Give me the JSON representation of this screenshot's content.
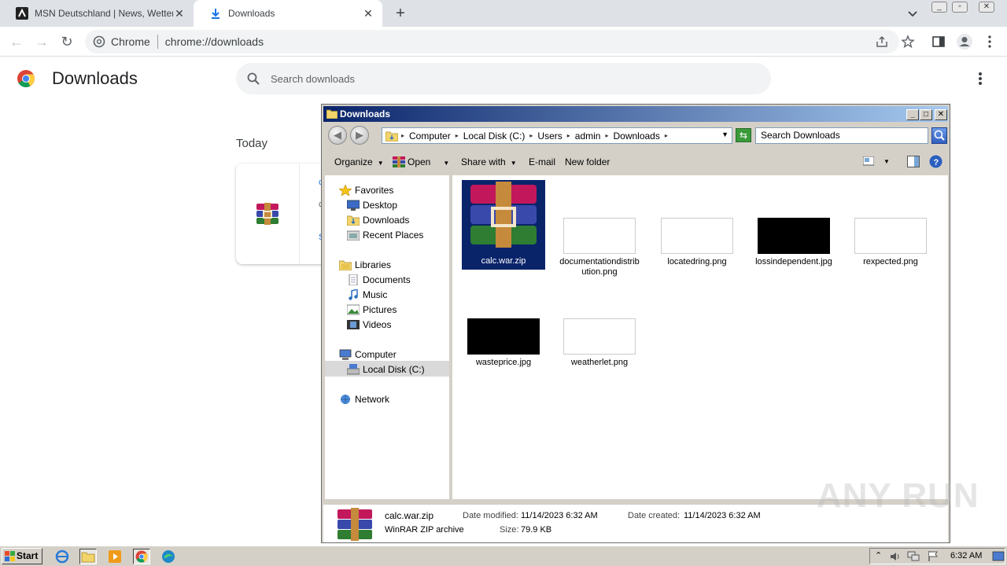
{
  "browser": {
    "tabs": [
      {
        "title": "MSN Deutschland | News, Wetter, Sport",
        "active": false
      },
      {
        "title": "Downloads",
        "active": true
      }
    ],
    "omnibox": {
      "chip": "Chrome",
      "url": "chrome://downloads"
    }
  },
  "downloads_page": {
    "title": "Downloads",
    "search_placeholder": "Search downloads",
    "section": "Today"
  },
  "explorer": {
    "title": "Downloads",
    "breadcrumb": [
      "Computer",
      "Local Disk (C:)",
      "Users",
      "admin",
      "Downloads"
    ],
    "search_placeholder": "Search Downloads",
    "commands": {
      "organize": "Organize",
      "open": "Open",
      "share": "Share with",
      "email": "E-mail",
      "new_folder": "New folder"
    },
    "nav": {
      "favorites": "Favorites",
      "desktop": "Desktop",
      "downloads": "Downloads",
      "recent": "Recent Places",
      "libraries": "Libraries",
      "documents": "Documents",
      "music": "Music",
      "pictures": "Pictures",
      "videos": "Videos",
      "computer": "Computer",
      "local_disk": "Local Disk (C:)",
      "network": "Network"
    },
    "files": [
      {
        "name": "calc.war.zip",
        "kind": "winrar",
        "selected": true
      },
      {
        "name": "documentationdistribution.png",
        "kind": "white"
      },
      {
        "name": "locatedring.png",
        "kind": "white"
      },
      {
        "name": "lossindependent.jpg",
        "kind": "black"
      },
      {
        "name": "rexpected.png",
        "kind": "white"
      },
      {
        "name": "wasteprice.jpg",
        "kind": "black"
      },
      {
        "name": "weatherlet.png",
        "kind": "white"
      }
    ],
    "details": {
      "name": "calc.war.zip",
      "type": "WinRAR ZIP archive",
      "modified_label": "Date modified:",
      "modified": "11/14/2023 6:32 AM",
      "created_label": "Date created:",
      "created": "11/14/2023 6:32 AM",
      "size_label": "Size:",
      "size": "79.9 KB"
    }
  },
  "taskbar": {
    "start": "Start",
    "clock": "6:32 AM"
  },
  "watermark": "ANY RUN"
}
